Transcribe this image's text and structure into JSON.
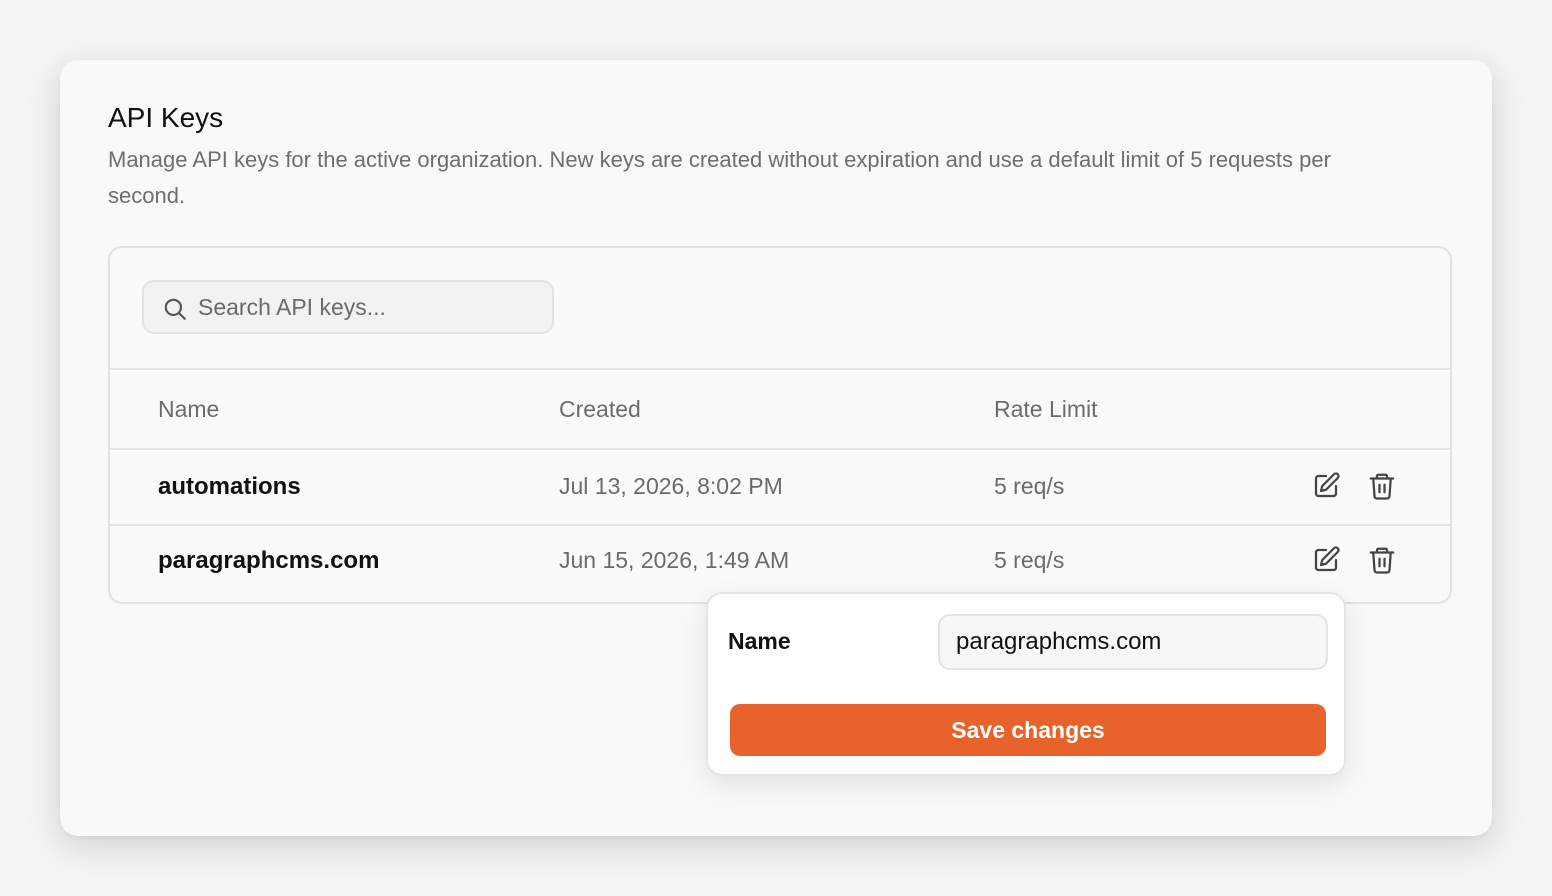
{
  "header": {
    "title": "API Keys",
    "description": "Manage API keys for the active organization. New keys are created without expiration and use a default limit of 5 requests per second."
  },
  "search": {
    "placeholder": "Search API keys...",
    "value": "",
    "icon": "search-icon"
  },
  "table": {
    "columns": [
      "Name",
      "Created",
      "Rate Limit"
    ],
    "rows": [
      {
        "name": "automations",
        "created": "Jul 13, 2026, 8:02 PM",
        "rate_limit": "5 req/s",
        "actions": [
          "edit-icon",
          "trash-icon"
        ]
      },
      {
        "name": "paragraphcms.com",
        "created": "Jun 15, 2026, 1:49 AM",
        "rate_limit": "5 req/s",
        "actions": [
          "edit-icon",
          "trash-icon"
        ]
      }
    ]
  },
  "edit_popover": {
    "label": "Name",
    "value": "paragraphcms.com",
    "save_label": "Save changes"
  },
  "colors": {
    "accent": "#e8632c",
    "muted_text": "#6b6b6b",
    "border": "#e1e1e1"
  }
}
